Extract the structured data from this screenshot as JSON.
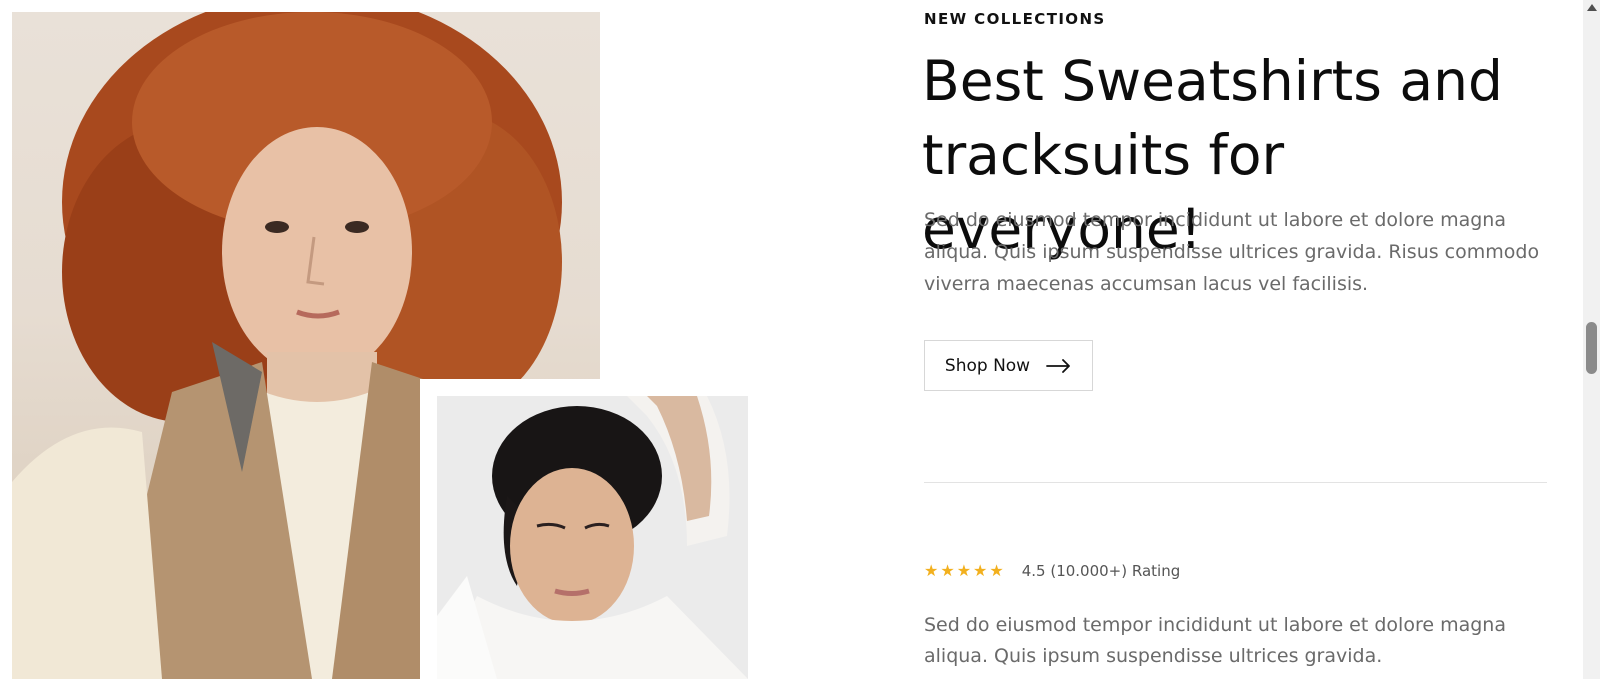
{
  "hero": {
    "kicker": "NEW COLLECTIONS",
    "title": "Best Sweatshirts and tracksuits for everyone!",
    "description": "Sed do eiusmod tempor incididunt ut labore et dolore magna aliqua. Quis ipsum suspendisse ultrices gravida. Risus commodo viverra maecenas accumsan lacus vel facilisis.",
    "cta_label": "Shop Now",
    "cta_icon": "arrow-right-icon"
  },
  "rating": {
    "stars": 5,
    "star_icon": "star-icon",
    "star_color": "#f2b01e",
    "text": "4.5 (10.000+) Rating"
  },
  "secondary_text": "Sed do eiusmod tempor incididunt ut labore et dolore magna aliqua. Quis ipsum suspendisse ultrices gravida.",
  "images": {
    "main": "woman-with-curly-red-hair-in-beige-vest",
    "secondary": "man-in-white-shirt-arm-raised"
  },
  "colors": {
    "text_primary": "#111111",
    "text_muted": "#6a6a6a",
    "divider": "#e3e3e3"
  }
}
